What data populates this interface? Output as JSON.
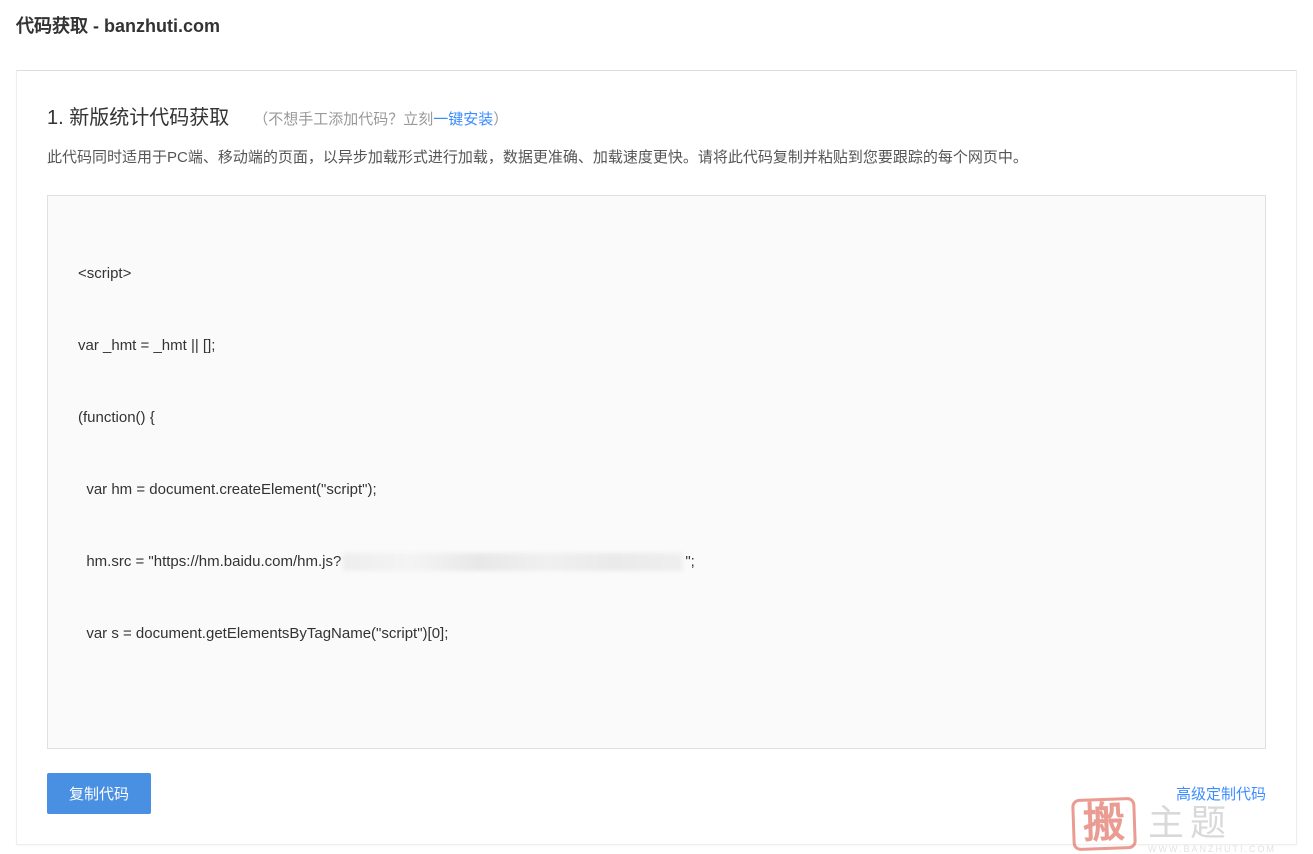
{
  "pageTitle": "代码获取 - banzhuti.com",
  "section": {
    "title": "1. 新版统计代码获取",
    "subtitlePrefix": "（不想手工添加代码？立刻",
    "subtitleLink": "一键安装",
    "subtitleSuffix": "）"
  },
  "description": "此代码同时适用于PC端、移动端的页面，以异步加载形式进行加载，数据更准确、加载速度更快。请将此代码复制并粘贴到您要跟踪的每个网页中。",
  "code": {
    "line1": "<script>",
    "line2": "var _hmt = _hmt || [];",
    "line3": "(function() {",
    "line4": "  var hm = document.createElement(\"script\");",
    "line5a": "  hm.src = \"https://hm.baidu.com/hm.js?",
    "line5b": "\";",
    "line6": "  var s = document.getElementsByTagName(\"script\")[0];"
  },
  "buttons": {
    "copy": "复制代码",
    "advanced": "高级定制代码"
  },
  "watermark": {
    "stamp": "搬",
    "text": "主题",
    "url": "WWW.BANZHUTI.COM"
  }
}
